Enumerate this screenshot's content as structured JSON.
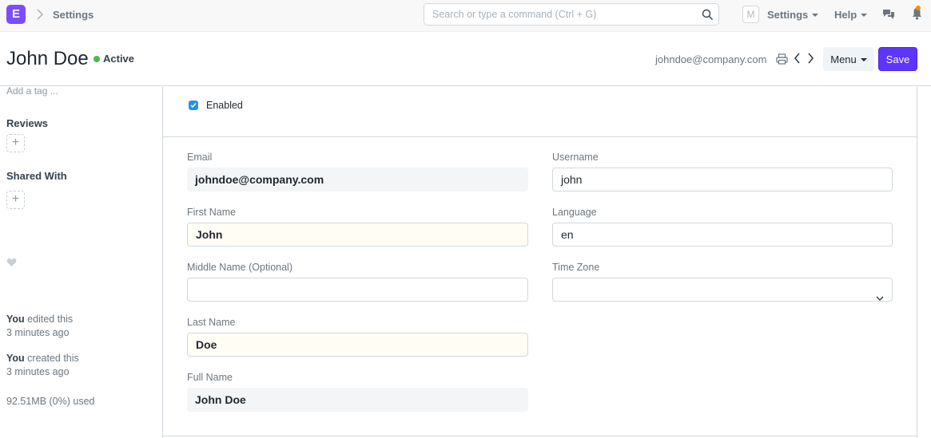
{
  "navbar": {
    "logo_letter": "E",
    "breadcrumb": "Settings",
    "search_placeholder": "Search or type a command (Ctrl + G)",
    "avatar_letter": "M",
    "settings_label": "Settings",
    "help_label": "Help",
    "notification_dot_color": "#ff8c00"
  },
  "header": {
    "title": "John Doe",
    "status": "Active",
    "status_color": "#48bb45",
    "email": "johndoe@company.com",
    "menu_label": "Menu",
    "save_label": "Save",
    "accent_color": "#5e35ff"
  },
  "sidebar": {
    "add_tag": "Add a tag ...",
    "reviews_label": "Reviews",
    "shared_with_label": "Shared With",
    "activity": [
      {
        "actor": "You",
        "action": " edited this",
        "time": "3 minutes ago"
      },
      {
        "actor": "You",
        "action": " created this",
        "time": "3 minutes ago"
      }
    ],
    "storage": "92.51MB (0%) used"
  },
  "form": {
    "enabled_label": "Enabled",
    "enabled_checked": true,
    "email": {
      "label": "Email",
      "value": "johndoe@company.com"
    },
    "first_name": {
      "label": "First Name",
      "value": "John"
    },
    "middle_name": {
      "label": "Middle Name (Optional)",
      "value": ""
    },
    "last_name": {
      "label": "Last Name",
      "value": "Doe"
    },
    "full_name": {
      "label": "Full Name",
      "value": "John Doe"
    },
    "username": {
      "label": "Username",
      "value": "john"
    },
    "language": {
      "label": "Language",
      "value": "en"
    },
    "time_zone": {
      "label": "Time Zone",
      "value": ""
    }
  }
}
